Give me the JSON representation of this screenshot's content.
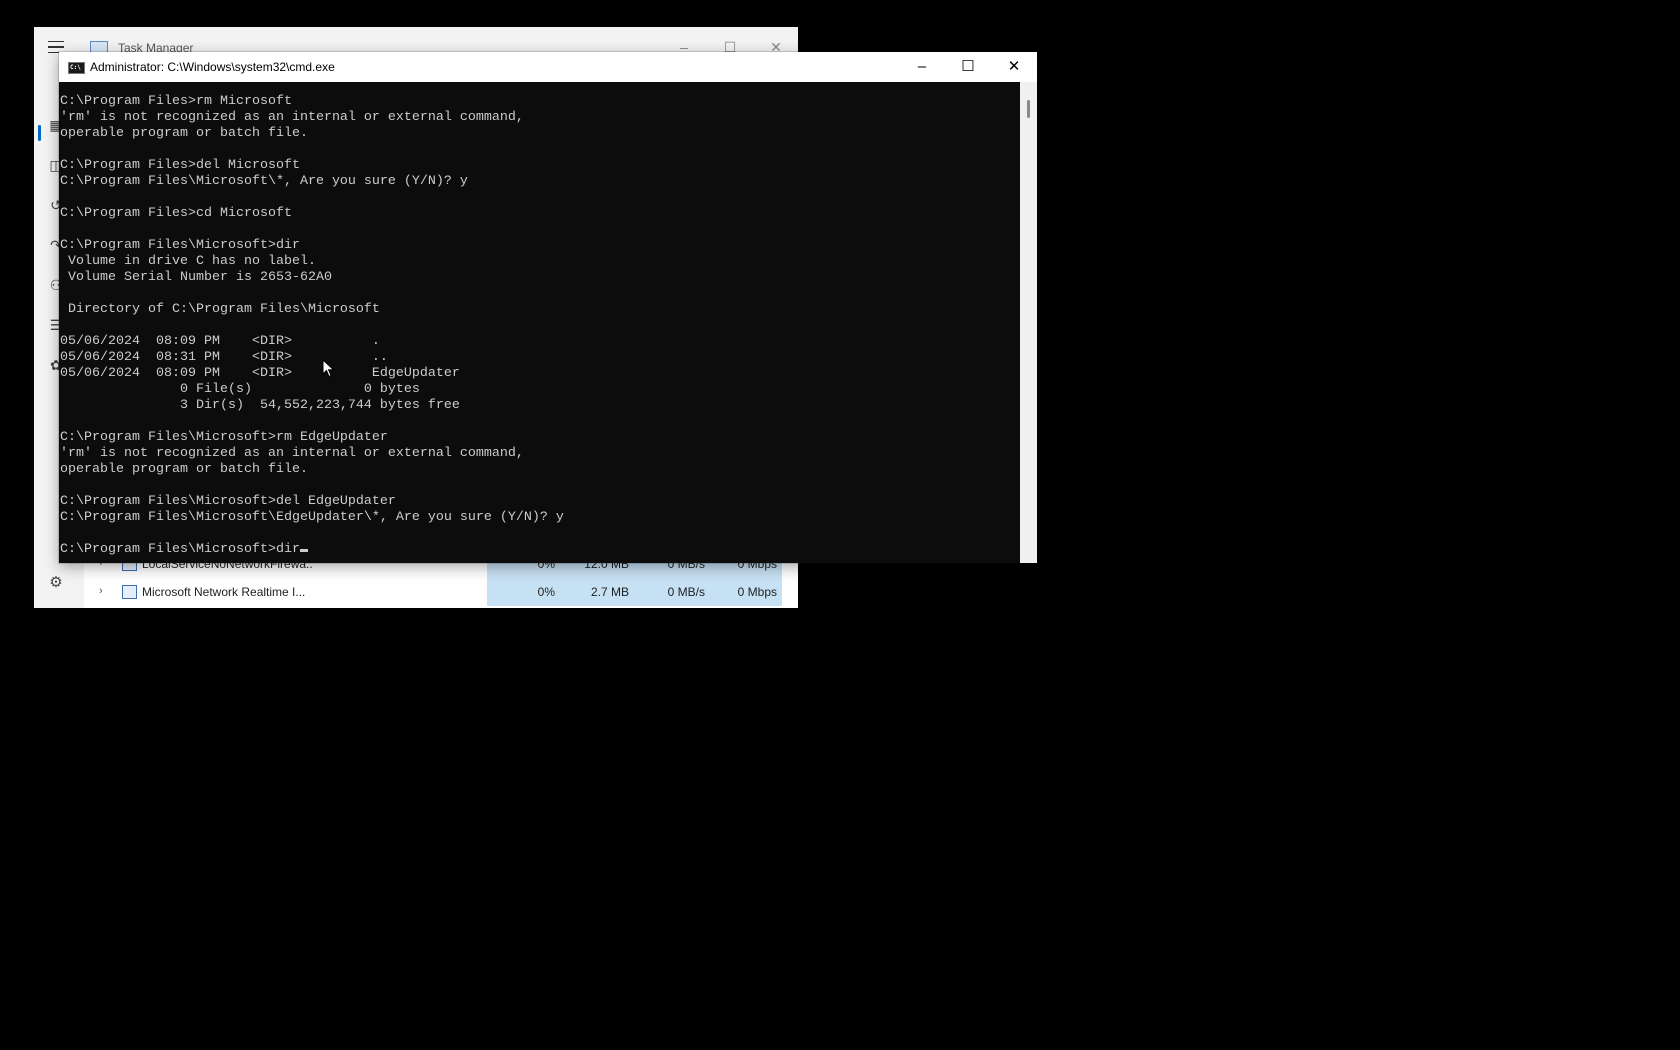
{
  "task_manager": {
    "title": "Task Manager",
    "controls": {
      "minimize": "–",
      "maximize": "☐",
      "close": "✕"
    },
    "sidebar_icons": [
      "processes-icon",
      "performance-icon",
      "app-history-icon",
      "startup-apps-icon",
      "users-icon",
      "details-icon",
      "services-icon"
    ],
    "settings_icon": "gear-icon",
    "processes": [
      {
        "name": "LocalServiceNoNetworkFirewa...",
        "cpu": "0%",
        "memory": "12.0 MB",
        "disk": "0 MB/s",
        "network": "0 Mbps"
      },
      {
        "name": "Microsoft Network Realtime I...",
        "cpu": "0%",
        "memory": "2.7 MB",
        "disk": "0 MB/s",
        "network": "0 Mbps"
      }
    ]
  },
  "cmd": {
    "title": "Administrator: C:\\Windows\\system32\\cmd.exe",
    "icon_text": "C:\\",
    "controls": {
      "minimize": "–",
      "maximize": "☐",
      "close": "✕"
    },
    "console_text": "C:\\Program Files>rm Microsoft\n'rm' is not recognized as an internal or external command,\noperable program or batch file.\n\nC:\\Program Files>del Microsoft\nC:\\Program Files\\Microsoft\\*, Are you sure (Y/N)? y\n\nC:\\Program Files>cd Microsoft\n\nC:\\Program Files\\Microsoft>dir\n Volume in drive C has no label.\n Volume Serial Number is 2653-62A0\n\n Directory of C:\\Program Files\\Microsoft\n\n05/06/2024  08:09 PM    <DIR>          .\n05/06/2024  08:31 PM    <DIR>          ..\n05/06/2024  08:09 PM    <DIR>          EdgeUpdater\n               0 File(s)              0 bytes\n               3 Dir(s)  54,552,223,744 bytes free\n\nC:\\Program Files\\Microsoft>rm EdgeUpdater\n'rm' is not recognized as an internal or external command,\noperable program or batch file.\n\nC:\\Program Files\\Microsoft>del EdgeUpdater\nC:\\Program Files\\Microsoft\\EdgeUpdater\\*, Are you sure (Y/N)? y\n\nC:\\Program Files\\Microsoft>dir"
  },
  "colors": {
    "console_bg": "#0c0c0c",
    "console_fg": "#cccccc",
    "accent": "#0067c0",
    "heatmap": "#c7e1f4"
  }
}
